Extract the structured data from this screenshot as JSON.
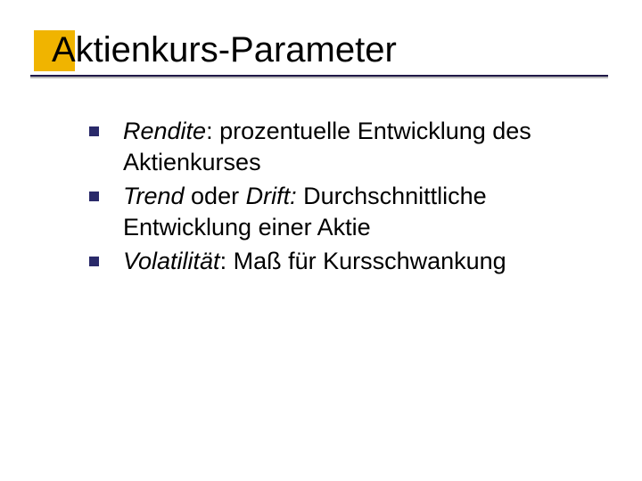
{
  "title": "Aktienkurs-Parameter",
  "bullets": [
    {
      "term": "Rendite",
      "sep": ": ",
      "rest": "prozentuelle Entwicklung des Aktienkurses"
    },
    {
      "term": "Trend",
      "sep": " oder ",
      "term2": "Drift:",
      "rest": " Durchschnittliche Entwicklung einer Aktie"
    },
    {
      "term": "Volatilität",
      "sep": ": ",
      "rest": "Maß für Kursschwankung"
    }
  ]
}
